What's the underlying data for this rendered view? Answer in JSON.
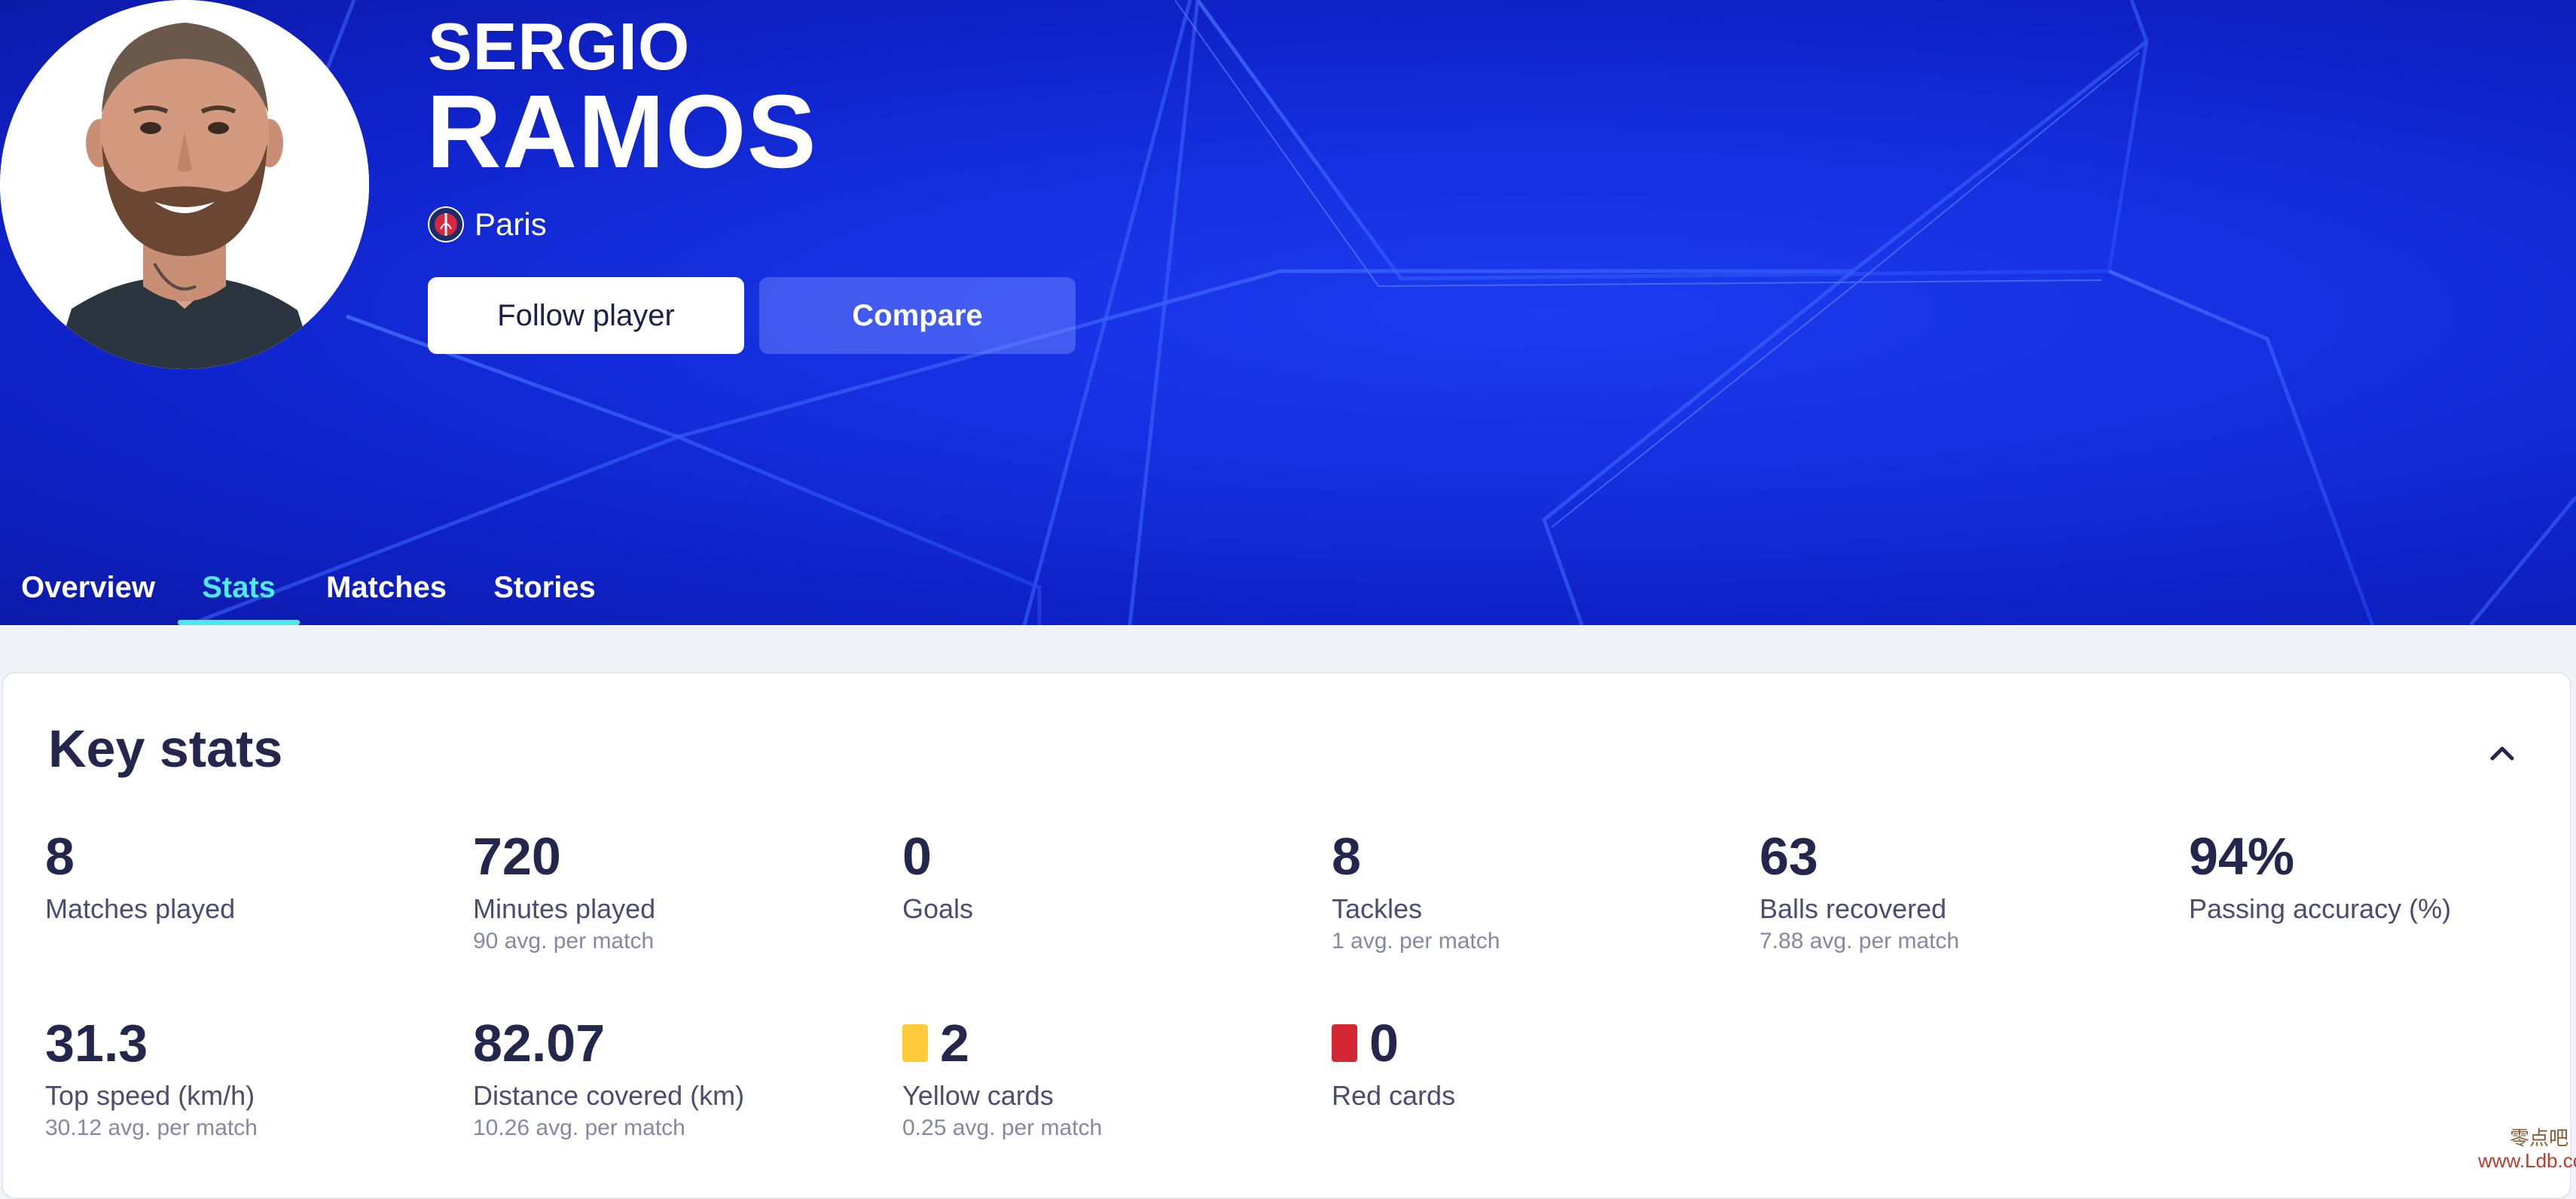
{
  "player": {
    "first_name": "SERGIO",
    "last_name": "RAMOS",
    "club": "Paris"
  },
  "actions": {
    "follow_label": "Follow player",
    "compare_label": "Compare"
  },
  "tabs": [
    {
      "label": "Overview",
      "active": false
    },
    {
      "label": "Stats",
      "active": true
    },
    {
      "label": "Matches",
      "active": false
    },
    {
      "label": "Stories",
      "active": false
    }
  ],
  "key_stats": {
    "title": "Key stats",
    "collapse_icon": "chevron-up-icon",
    "items": [
      {
        "value": "8",
        "label": "Matches played",
        "sub": ""
      },
      {
        "value": "720",
        "label": "Minutes played",
        "sub": "90 avg. per match"
      },
      {
        "value": "0",
        "label": "Goals",
        "sub": ""
      },
      {
        "value": "8",
        "label": "Tackles",
        "sub": "1 avg. per match"
      },
      {
        "value": "63",
        "label": "Balls recovered",
        "sub": "7.88 avg. per match"
      },
      {
        "value": "94%",
        "label": "Passing accuracy (%)",
        "sub": ""
      },
      {
        "value": "31.3",
        "label": "Top speed (km/h)",
        "sub": "30.12 avg. per match"
      },
      {
        "value": "82.07",
        "label": "Distance covered (km)",
        "sub": "10.26 avg. per match"
      },
      {
        "value": "2",
        "label": "Yellow cards",
        "sub": "0.25 avg. per match",
        "icon": "yellow-card-icon"
      },
      {
        "value": "0",
        "label": "Red cards",
        "sub": "",
        "icon": "red-card-icon"
      }
    ]
  },
  "watermark": {
    "line1": "零点吧",
    "line2": "www.Ldb.cc"
  },
  "colors": {
    "hero_blue": "#1530e0",
    "accent_cyan": "#52e8f0",
    "text_dark": "#23264d",
    "yellow_card": "#ffcb3b",
    "red_card": "#d32733"
  }
}
